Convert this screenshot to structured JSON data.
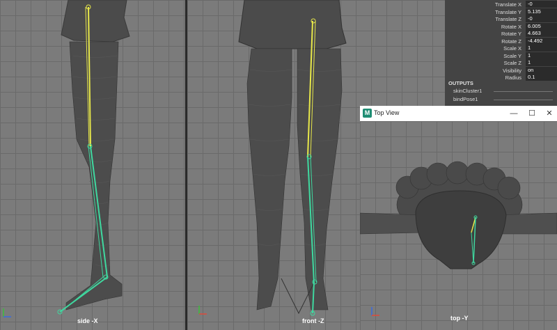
{
  "attributes": [
    {
      "label": "Translate X",
      "value": "-0"
    },
    {
      "label": "Translate Y",
      "value": "5.135"
    },
    {
      "label": "Translate Z",
      "value": "-0"
    },
    {
      "label": "Rotate X",
      "value": "6.005"
    },
    {
      "label": "Rotate Y",
      "value": "4.663"
    },
    {
      "label": "Rotate Z",
      "value": "-4.492"
    },
    {
      "label": "Scale X",
      "value": "1"
    },
    {
      "label": "Scale Y",
      "value": "1"
    },
    {
      "label": "Scale Z",
      "value": "1"
    },
    {
      "label": "Visibility",
      "value": "on"
    },
    {
      "label": "Radius",
      "value": "0.1"
    }
  ],
  "outputs": {
    "heading": "OUTPUTS",
    "items": [
      "skinCluster1",
      "bindPose1"
    ]
  },
  "top_view_window": {
    "title": "Top View",
    "icon_letter": "M",
    "minimize": "—",
    "maximize": "☐",
    "close": "✕"
  },
  "viewports": {
    "side": "side -X",
    "front": "front -Z",
    "top": "top -Y"
  },
  "colors": {
    "bone_yellow": "#e8e84a",
    "bone_green": "#3fd9a0",
    "viewport_bg": "#7b7b7b"
  }
}
